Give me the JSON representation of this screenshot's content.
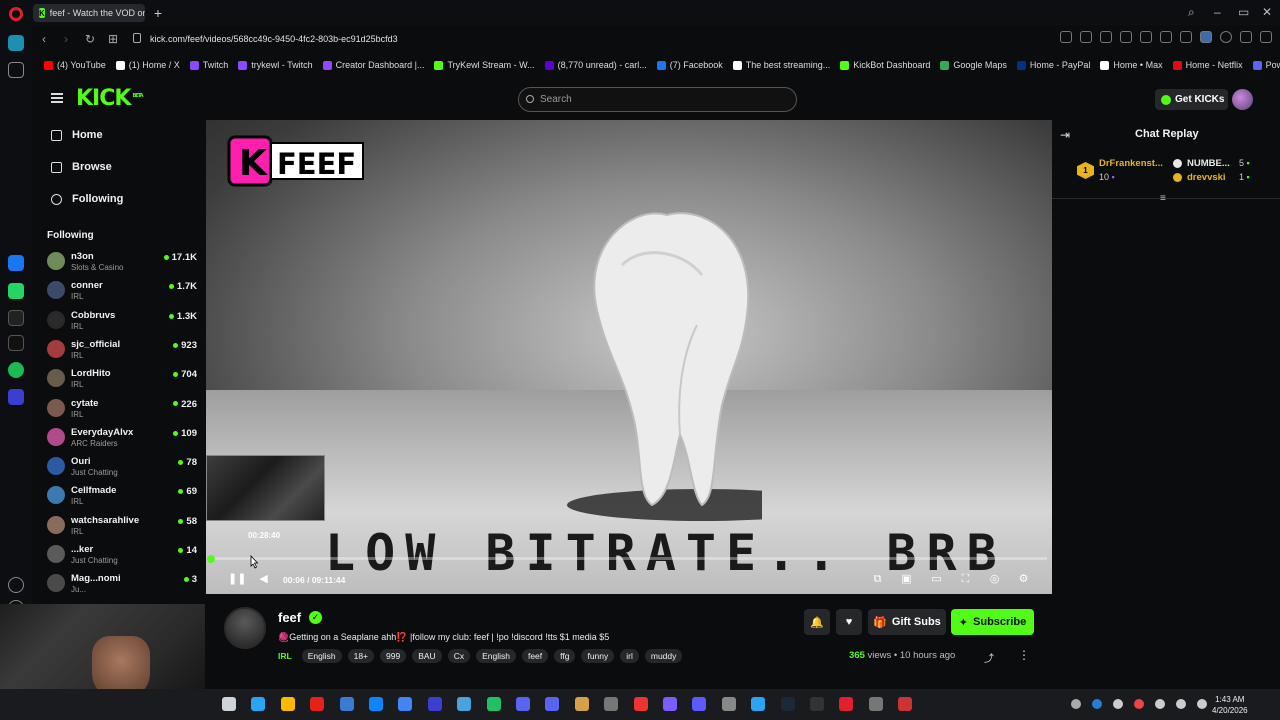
{
  "browser": {
    "tab_title": "feef - Watch the VOD on",
    "url": "kick.com/feef/videos/568cc49c-9450-4fc2-803b-ec91d25bcfd3",
    "bookmarks": [
      {
        "label": "(4) YouTube",
        "color": "#ff0000"
      },
      {
        "label": "(1) Home / X",
        "color": "#ffffff"
      },
      {
        "label": "Twitch",
        "color": "#9146ff"
      },
      {
        "label": "trykewl - Twitch",
        "color": "#9146ff"
      },
      {
        "label": "Creator Dashboard |...",
        "color": "#9146ff"
      },
      {
        "label": "TryKewl Stream - W...",
        "color": "#53fc18"
      },
      {
        "label": "(8,770 unread) - carl...",
        "color": "#6001d2"
      },
      {
        "label": "(7) Facebook",
        "color": "#1877f2"
      },
      {
        "label": "The best streaming...",
        "color": "#ffffff"
      },
      {
        "label": "KickBot Dashboard",
        "color": "#53fc18"
      },
      {
        "label": "Google Maps",
        "color": "#34a853"
      },
      {
        "label": "Home - PayPal",
        "color": "#003087"
      },
      {
        "label": "Home • Max",
        "color": "#ffffff"
      },
      {
        "label": "Home - Netflix",
        "color": "#e50914"
      },
      {
        "label": "Powerchat",
        "color": "#5865f2"
      }
    ]
  },
  "header": {
    "logo": "KICK",
    "logo_tag": "BETA",
    "search_placeholder": "Search",
    "get_kicks_label": "Get KICKs"
  },
  "nav": {
    "home": "Home",
    "browse": "Browse",
    "following": "Following",
    "following_header": "Following"
  },
  "following": [
    {
      "name": "n3on",
      "category": "Slots & Casino",
      "viewers": "17.1K",
      "color": "#6e8b5a"
    },
    {
      "name": "conner",
      "category": "IRL",
      "viewers": "1.7K",
      "color": "#3a4a6a"
    },
    {
      "name": "Cobbruvs",
      "category": "IRL",
      "viewers": "1.3K",
      "color": "#2a2a2a"
    },
    {
      "name": "sjc_official",
      "category": "IRL",
      "viewers": "923",
      "color": "#a33d3d"
    },
    {
      "name": "LordHito",
      "category": "IRL",
      "viewers": "704",
      "color": "#6a5a4a"
    },
    {
      "name": "cytate",
      "category": "IRL",
      "viewers": "226",
      "color": "#7a5a4a"
    },
    {
      "name": "EverydayAlvx",
      "category": "ARC Raiders",
      "viewers": "109",
      "color": "#b04a8a"
    },
    {
      "name": "Ouri",
      "category": "Just Chatting",
      "viewers": "78",
      "color": "#2a5aa0"
    },
    {
      "name": "Cellfmade",
      "category": "IRL",
      "viewers": "69",
      "color": "#3a7ab0"
    },
    {
      "name": "watchsarahlive",
      "category": "IRL",
      "viewers": "58",
      "color": "#8a6a5a"
    },
    {
      "name": "...ker",
      "category": "Just Chatting",
      "viewers": "14",
      "color": "#5a5a5a"
    },
    {
      "name": "Mag...nomi",
      "category": "Ju...",
      "viewers": "3",
      "color": "#4a4a4a"
    }
  ],
  "player": {
    "overlay_text": "LOW BITRATE.. BRB",
    "channel_logo": "FEEF",
    "preview_time": "00:28:40",
    "current_time": "00:06",
    "duration": "09:11:44",
    "time_display": "00:06 / 09:11:44",
    "progress_fraction": 0.0002
  },
  "chat": {
    "title": "Chat Replay",
    "gifter_rank": "1",
    "gifter_name": "DrFrankenst...",
    "gifter_count": "10",
    "leaders": [
      {
        "name": "NUMBE...",
        "count": "5",
        "color": "#e8e8e8"
      },
      {
        "name": "drevvski",
        "count": "1",
        "color": "#e9b320"
      }
    ]
  },
  "stream": {
    "channel_name": "feef",
    "title": "🧶Getting on a Seaplane ahh⁉️ |follow my club: feef | !po !discord !tts $1 media $5",
    "category": "IRL",
    "tags": [
      "English",
      "18+",
      "999",
      "BAU",
      "Cx",
      "English",
      "feef",
      "ffg",
      "funny",
      "irl",
      "muddy"
    ],
    "views_count": "365",
    "views_label": "views",
    "separator": "•",
    "time_ago": "10 hours ago",
    "gift_subs_label": "Gift Subs",
    "subscribe_label": "Subscribe"
  },
  "taskbar": {
    "time": "1:43 AM",
    "date": "4/20/2026"
  },
  "colors": {
    "accent": "#53fc18",
    "gold": "#e9b320",
    "background": "#0b0c0e"
  }
}
